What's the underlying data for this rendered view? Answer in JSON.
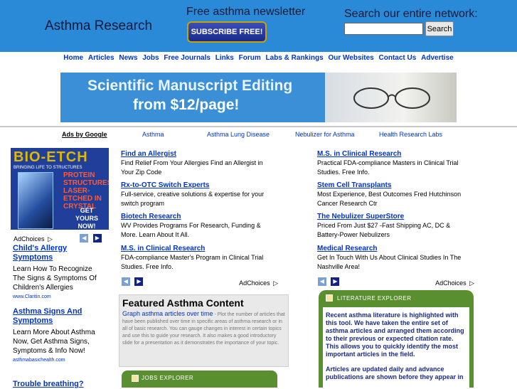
{
  "header": {
    "site_title": "Asthma Research",
    "newsletter_title": "Free asthma newsletter",
    "subscribe_label": "SUBSCRIBE FREE!",
    "search_title": "Search our entire network:",
    "search_value": "",
    "search_button": "Search"
  },
  "nav": {
    "items": [
      "Home",
      "Articles",
      "News",
      "Jobs",
      "Free Journals",
      "Links",
      "Forum",
      "Labs & Rankings",
      "Our Websites",
      "Contact Us",
      "Advertise"
    ]
  },
  "banner": {
    "line1": "Scientific Manuscript Editing",
    "line2": "from $12/page!"
  },
  "ads_row": {
    "ads_by": "Ads by Google",
    "links": [
      "Asthma",
      "Asthma Lung Disease",
      "Nebulizer for Asthma",
      "Health Research Labs"
    ]
  },
  "left_ad": {
    "logo": "BIO-ETCH",
    "tagline": "BRINGING LIFE TO STRUCTURES",
    "red_text": "PROTEIN STRUCTURES LASER-ETCHED IN CRYSTAL",
    "cta": "GET YOURS NOW!"
  },
  "left_links": [
    {
      "title": "Child's Allergy Symptoms",
      "body": "Learn How To Recognize The Signs & Symptoms Of Children's Allergies",
      "url": "www.Claritin.com"
    },
    {
      "title": "Asthma Signs And Symptoms",
      "body": "Learn More About Asthma Now, Get Asthma Signs, Symptoms & Info Now!",
      "url": "asthmabasichealth.com"
    },
    {
      "title": "Trouble breathing?",
      "body": "",
      "url": ""
    }
  ],
  "adchoices": "AdChoices",
  "mid_ads": [
    {
      "title": "Find an Allergist",
      "body": "Find Relief From Your Allergies Find an Allergist in Your Zip Code"
    },
    {
      "title": "Rx-to-OTC Switch Experts",
      "body": "Full-service, creative solutions & expertise for your switch program"
    },
    {
      "title": "Biotech Research",
      "body": "WV Provides Programs For Research, Funding & More. Learn About It All."
    },
    {
      "title": "M.S. in Clinical Research",
      "body": "FDA-compliance Master's Program in Clinical Trial Studies. Free Info."
    }
  ],
  "right_ads": [
    {
      "title": "M.S. in Clinical Research",
      "body": "Practical FDA-compliance Masters in Clinical Trial Studies. Free Info."
    },
    {
      "title": "Stem Cell Transplants",
      "body": "Most Experience, Best Outcomes Fred Hutchinson Cancer Research Ctr"
    },
    {
      "title": "The Nebulizer SuperStore",
      "body": "Priced From Just $27 -Fast Shipping AC, DC & Battery-Power Nebulizers"
    },
    {
      "title": "Medical Research",
      "body": "Get In Touch With Us About Clinical Studies In The Nashville Area!"
    }
  ],
  "featured": {
    "title": "Featured Asthma Content",
    "link": "Graph asthma articles over time",
    "desc": " - Plot the number of articles that have been published over time in specific areas of asthma research or in all of basic research. You can gauge changes in interest in certain topics and use this to guide your research. It also makes a good introductory slide for a presentation as it demonstrates the importance of your topic."
  },
  "jobs_explorer": "JOBS EXPLORER",
  "literature_explorer": {
    "title": "LITERATURE EXPLORER",
    "p1": "Recent asthma literature is highlighted with this tool. We have taken the entire set of asthma articles and arranged them according to their previous or expected citation rate. This allows you to quickly identify the most important articles in the field.",
    "p2": "Articles are updated daily and advance publications are shown before they appear in"
  }
}
